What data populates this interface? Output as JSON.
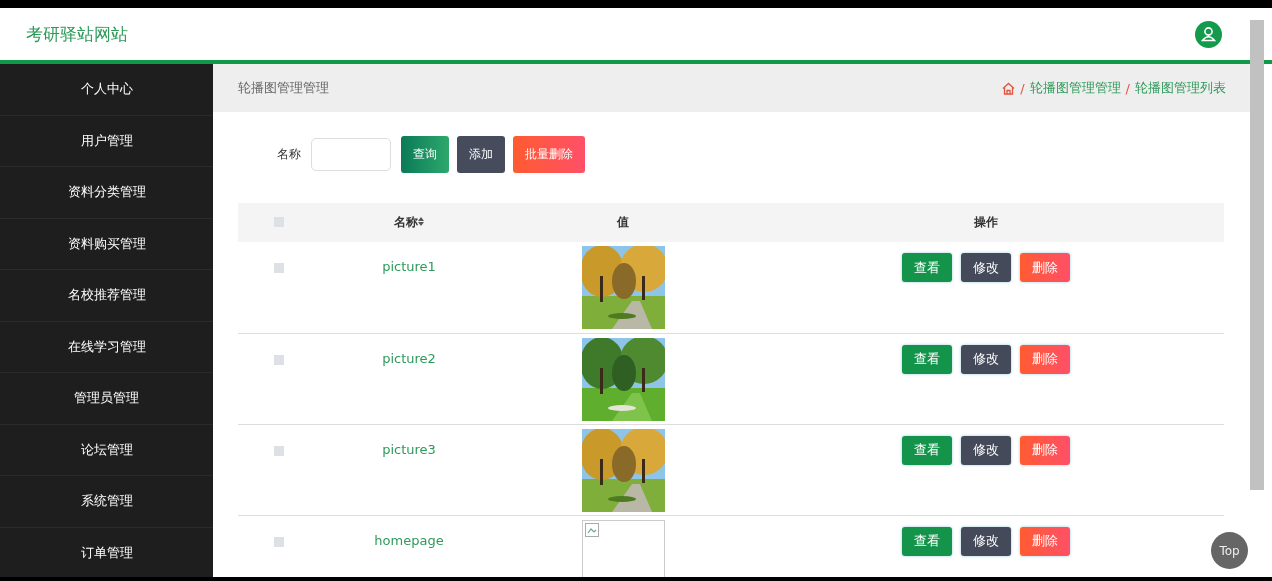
{
  "header": {
    "title": "考研驿站网站"
  },
  "sidebar": {
    "items": [
      {
        "label": "个人中心"
      },
      {
        "label": "用户管理"
      },
      {
        "label": "资料分类管理"
      },
      {
        "label": "资料购买管理"
      },
      {
        "label": "名校推荐管理"
      },
      {
        "label": "在线学习管理"
      },
      {
        "label": "管理员管理"
      },
      {
        "label": "论坛管理"
      },
      {
        "label": "系统管理"
      },
      {
        "label": "订单管理"
      }
    ]
  },
  "breadcrumb": {
    "title": "轮播图管理管理",
    "separator": "/",
    "path": [
      "轮播图管理管理",
      "轮播图管理列表"
    ]
  },
  "search": {
    "label": "名称",
    "buttons": [
      {
        "label": "查询",
        "kind": "search"
      },
      {
        "label": "添加",
        "kind": "add"
      },
      {
        "label": "批量删除",
        "kind": "delete"
      }
    ]
  },
  "table": {
    "columns": [
      {
        "kind": "checkbox",
        "checked": false
      },
      {
        "kind": "text",
        "label": "名称",
        "sortable": true
      },
      {
        "kind": "text",
        "label": "值"
      },
      {
        "kind": "text",
        "label": "操作"
      }
    ],
    "rows": [
      {
        "checked": false,
        "name": "picture1",
        "image": {
          "kind": "picture"
        },
        "actions": [
          {
            "label": "查看",
            "kind": "view"
          },
          {
            "label": "修改",
            "kind": "edit"
          },
          {
            "label": "删除",
            "kind": "delete"
          }
        ]
      },
      {
        "checked": false,
        "name": "picture2",
        "image": {
          "kind": "picture"
        },
        "actions": [
          {
            "label": "查看",
            "kind": "view"
          },
          {
            "label": "修改",
            "kind": "edit"
          },
          {
            "label": "删除",
            "kind": "delete"
          }
        ]
      },
      {
        "checked": false,
        "name": "picture3",
        "image": {
          "kind": "picture"
        },
        "actions": [
          {
            "label": "查看",
            "kind": "view"
          },
          {
            "label": "修改",
            "kind": "edit"
          },
          {
            "label": "删除",
            "kind": "delete"
          }
        ]
      },
      {
        "checked": false,
        "name": "homepage",
        "image": {
          "kind": "broken"
        },
        "actions": [
          {
            "label": "查看",
            "kind": "view"
          },
          {
            "label": "修改",
            "kind": "edit"
          },
          {
            "label": "删除",
            "kind": "delete"
          }
        ]
      }
    ]
  },
  "back_to_top": "Top"
}
